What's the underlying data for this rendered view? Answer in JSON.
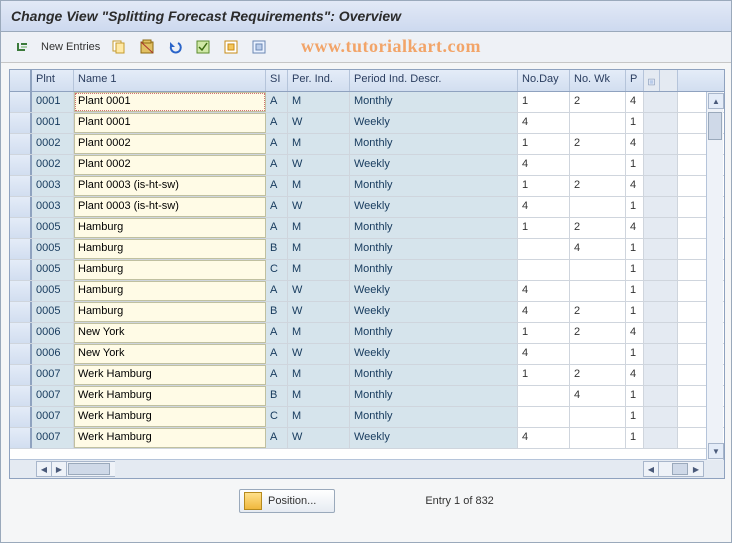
{
  "header": {
    "title": "Change View \"Splitting Forecast Requirements\": Overview"
  },
  "toolbar": {
    "new_entries_label": "New Entries"
  },
  "watermark": "www.tutorialkart.com",
  "columns": {
    "sel": "",
    "plnt": "Plnt",
    "name": "Name 1",
    "si": "SI",
    "per": "Per. Ind.",
    "desc": "Period Ind. Descr.",
    "day": "No.Day",
    "wk": "No. Wk",
    "p": "P"
  },
  "rows": [
    {
      "plnt": "0001",
      "name": "Plant 0001",
      "si": "A",
      "per": "M",
      "desc": "Monthly",
      "day": "1",
      "wk": "2",
      "p": "4"
    },
    {
      "plnt": "0001",
      "name": "Plant 0001",
      "si": "A",
      "per": "W",
      "desc": "Weekly",
      "day": "4",
      "wk": "",
      "p": "1"
    },
    {
      "plnt": "0002",
      "name": "Plant 0002",
      "si": "A",
      "per": "M",
      "desc": "Monthly",
      "day": "1",
      "wk": "2",
      "p": "4"
    },
    {
      "plnt": "0002",
      "name": "Plant 0002",
      "si": "A",
      "per": "W",
      "desc": "Weekly",
      "day": "4",
      "wk": "",
      "p": "1"
    },
    {
      "plnt": "0003",
      "name": "Plant 0003 (is-ht-sw)",
      "si": "A",
      "per": "M",
      "desc": "Monthly",
      "day": "1",
      "wk": "2",
      "p": "4"
    },
    {
      "plnt": "0003",
      "name": "Plant 0003 (is-ht-sw)",
      "si": "A",
      "per": "W",
      "desc": "Weekly",
      "day": "4",
      "wk": "",
      "p": "1"
    },
    {
      "plnt": "0005",
      "name": "Hamburg",
      "si": "A",
      "per": "M",
      "desc": "Monthly",
      "day": "1",
      "wk": "2",
      "p": "4"
    },
    {
      "plnt": "0005",
      "name": "Hamburg",
      "si": "B",
      "per": "M",
      "desc": "Monthly",
      "day": "",
      "wk": "4",
      "p": "1"
    },
    {
      "plnt": "0005",
      "name": "Hamburg",
      "si": "C",
      "per": "M",
      "desc": "Monthly",
      "day": "",
      "wk": "",
      "p": "1"
    },
    {
      "plnt": "0005",
      "name": "Hamburg",
      "si": "A",
      "per": "W",
      "desc": "Weekly",
      "day": "4",
      "wk": "",
      "p": "1"
    },
    {
      "plnt": "0005",
      "name": "Hamburg",
      "si": "B",
      "per": "W",
      "desc": "Weekly",
      "day": "4",
      "wk": "2",
      "p": "1"
    },
    {
      "plnt": "0006",
      "name": "New York",
      "si": "A",
      "per": "M",
      "desc": "Monthly",
      "day": "1",
      "wk": "2",
      "p": "4"
    },
    {
      "plnt": "0006",
      "name": "New York",
      "si": "A",
      "per": "W",
      "desc": "Weekly",
      "day": "4",
      "wk": "",
      "p": "1"
    },
    {
      "plnt": "0007",
      "name": "Werk Hamburg",
      "si": "A",
      "per": "M",
      "desc": "Monthly",
      "day": "1",
      "wk": "2",
      "p": "4"
    },
    {
      "plnt": "0007",
      "name": "Werk Hamburg",
      "si": "B",
      "per": "M",
      "desc": "Monthly",
      "day": "",
      "wk": "4",
      "p": "1"
    },
    {
      "plnt": "0007",
      "name": "Werk Hamburg",
      "si": "C",
      "per": "M",
      "desc": "Monthly",
      "day": "",
      "wk": "",
      "p": "1"
    },
    {
      "plnt": "0007",
      "name": "Werk Hamburg",
      "si": "A",
      "per": "W",
      "desc": "Weekly",
      "day": "4",
      "wk": "",
      "p": "1"
    }
  ],
  "footer": {
    "position_label": "Position...",
    "entry_text": "Entry 1 of 832"
  }
}
